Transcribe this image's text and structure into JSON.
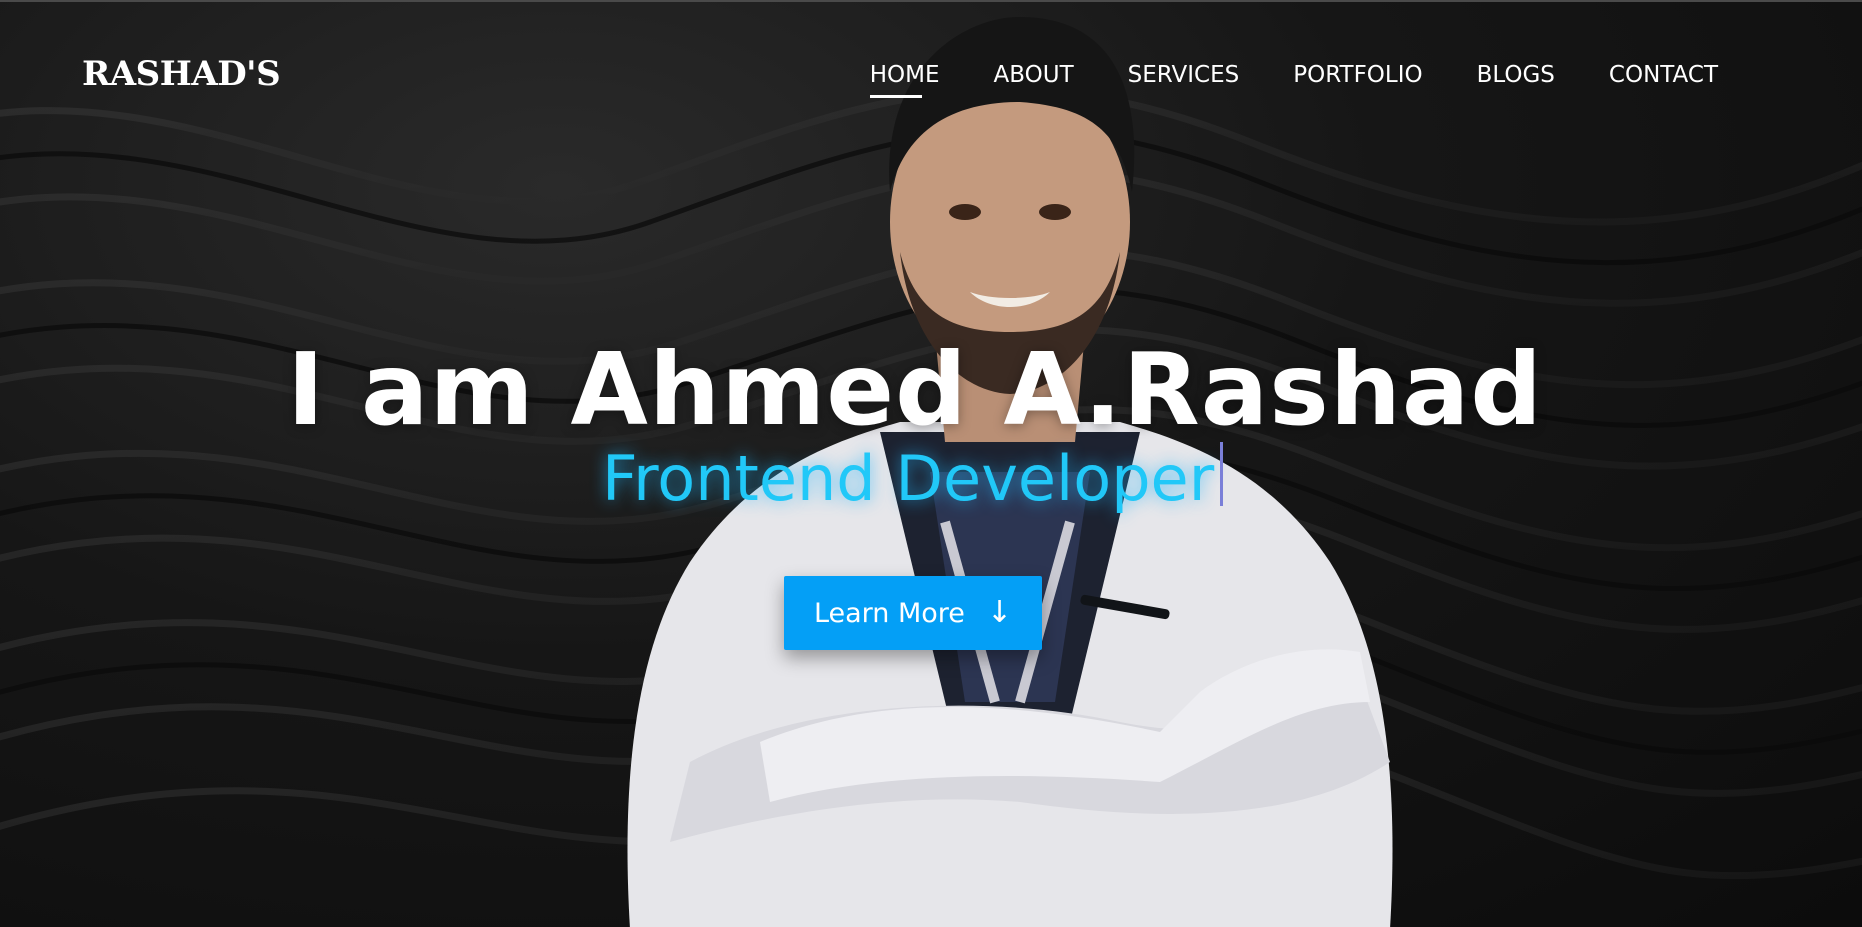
{
  "brand": {
    "logo_text": "RASHAD'S"
  },
  "nav": {
    "items": [
      {
        "label": "HOME",
        "active": true
      },
      {
        "label": "ABOUT",
        "active": false
      },
      {
        "label": "SERVICES",
        "active": false
      },
      {
        "label": "PORTFOLIO",
        "active": false
      },
      {
        "label": "BLOGS",
        "active": false
      },
      {
        "label": "CONTACT",
        "active": false
      }
    ]
  },
  "hero": {
    "headline": "I am Ahmed A.Rashad",
    "subtitle": "Frontend Developer",
    "cta_label": "Learn More",
    "cta_icon": "arrow-down-icon",
    "cta_glyph": "↓"
  },
  "colors": {
    "accent": "#049ff6",
    "subtitle": "#21c8f8",
    "background": "#141414",
    "text": "#ffffff"
  }
}
